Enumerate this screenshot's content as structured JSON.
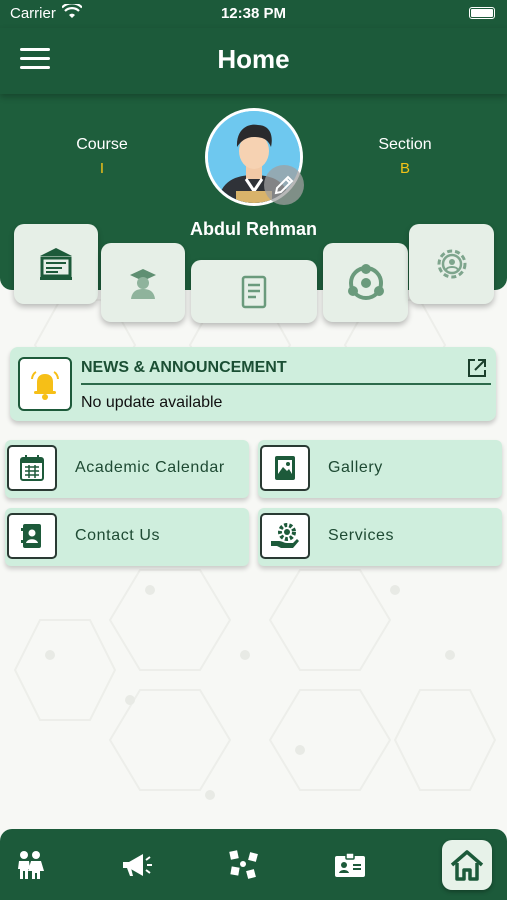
{
  "status_bar": {
    "carrier": "Carrier",
    "time": "12:38 PM"
  },
  "header": {
    "title": "Home"
  },
  "profile": {
    "course_label": "Course",
    "course_value": "I",
    "section_label": "Section",
    "section_value": "B",
    "name": "Abdul Rehman"
  },
  "quick_tiles": [
    "classroom-icon",
    "graduate-icon",
    "report-icon",
    "teamwork-icon",
    "settings-icon"
  ],
  "news": {
    "title": "NEWS & ANNOUNCEMENT",
    "text": "No update available"
  },
  "menu": [
    {
      "label": "Academic Calendar",
      "icon": "calendar-icon"
    },
    {
      "label": "Gallery",
      "icon": "gallery-icon"
    },
    {
      "label": "Contact Us",
      "icon": "contact-book-icon"
    },
    {
      "label": "Services",
      "icon": "services-icon"
    }
  ],
  "bottom_nav": [
    "students-icon",
    "megaphone-icon",
    "activities-icon",
    "id-card-icon",
    "home-icon"
  ],
  "colors": {
    "primary": "#1c5a3a",
    "card": "#cfeedd",
    "accent": "#f2c318"
  }
}
